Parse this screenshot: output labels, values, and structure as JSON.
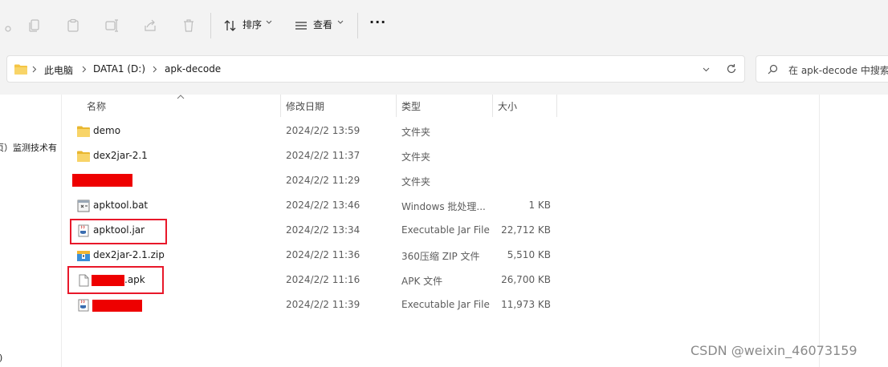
{
  "toolbar": {
    "sort_label": "排序",
    "view_label": "查看",
    "more_label": "···"
  },
  "address": {
    "crumbs": [
      "此电脑",
      "DATA1 (D:)",
      "apk-decode"
    ]
  },
  "search": {
    "placeholder": "在 apk-decode 中搜索"
  },
  "nav": {
    "partial_item_1": "页）监测技术有",
    "partial_item_2": "i)"
  },
  "columns": {
    "name": "名称",
    "date": "修改日期",
    "type": "类型",
    "size": "大小"
  },
  "files": [
    {
      "name": "demo",
      "date": "2024/2/2 13:59",
      "type": "文件夹",
      "size": "",
      "icon": "folder-icon"
    },
    {
      "name": "dex2jar-2.1",
      "date": "2024/2/2 11:37",
      "type": "文件夹",
      "size": "",
      "icon": "folder-icon"
    },
    {
      "name": "",
      "date": "2024/2/2 11:29",
      "type": "文件夹",
      "size": "",
      "icon": "folder-icon"
    },
    {
      "name": "apktool.bat",
      "date": "2024/2/2 13:46",
      "type": "Windows 批处理...",
      "size": "1 KB",
      "icon": "batch-file-icon"
    },
    {
      "name": "apktool.jar",
      "date": "2024/2/2 13:34",
      "type": "Executable Jar File",
      "size": "22,712 KB",
      "icon": "jar-file-icon"
    },
    {
      "name": "dex2jar-2.1.zip",
      "date": "2024/2/2 11:36",
      "type": "360压缩 ZIP 文件",
      "size": "5,510 KB",
      "icon": "zip-file-icon"
    },
    {
      "name": ".apk",
      "date": "2024/2/2 11:16",
      "type": "APK 文件",
      "size": "26,700 KB",
      "icon": "blank-file-icon"
    },
    {
      "name": "",
      "date": "2024/2/2 11:39",
      "type": "Executable Jar File",
      "size": "11,973 KB",
      "icon": "jar-file-icon"
    }
  ],
  "watermark": "CSDN @weixin_46073159",
  "colors": {
    "toolbar_bg": "#f3f3f3",
    "folder": "#f5c543",
    "highlight_box": "#e8182a",
    "redaction": "#ee0000"
  }
}
